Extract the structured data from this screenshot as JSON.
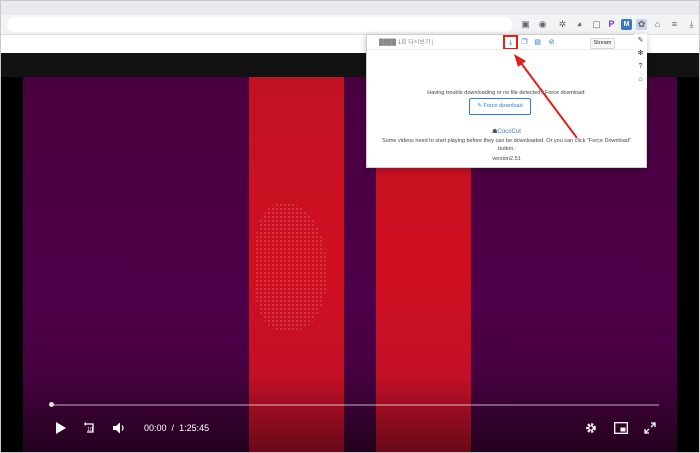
{
  "browser": {
    "extensions": [
      {
        "name": "screen-icon",
        "glyph": "▣"
      },
      {
        "name": "shield-icon",
        "glyph": "◉"
      },
      {
        "name": "puzzle-icon",
        "glyph": "✲"
      },
      {
        "name": "chart-icon",
        "glyph": "◕"
      },
      {
        "name": "box-icon",
        "glyph": "▢"
      },
      {
        "name": "p-icon",
        "glyph": "P"
      },
      {
        "name": "blue-ext-icon",
        "glyph": "M"
      },
      {
        "name": "coco-ext-icon",
        "glyph": "✿"
      },
      {
        "name": "house-icon",
        "glyph": "⌂"
      },
      {
        "name": "profile-icon",
        "glyph": "≡"
      },
      {
        "name": "download-icon",
        "glyph": "⤓"
      }
    ]
  },
  "popup": {
    "title": "████ 1회 다시보기 |",
    "stream_label": "Stream",
    "message": "Having trouble downloading or no file detected? Force download:",
    "force_button_label": "Force download",
    "brand_name": "CocoCut",
    "note": "Some videos need to start playing before they can be downloaded. Or you can click \"Force Download\" button.",
    "version": "version2.51"
  },
  "player": {
    "current_time": "00:00",
    "separator": "/",
    "duration": "1:25:45",
    "progress": 0.0
  },
  "colors": {
    "highlight": "#e0201a",
    "accent": "#2f80d9",
    "beam": "#c8101f",
    "video_bg": "#4a0040"
  }
}
